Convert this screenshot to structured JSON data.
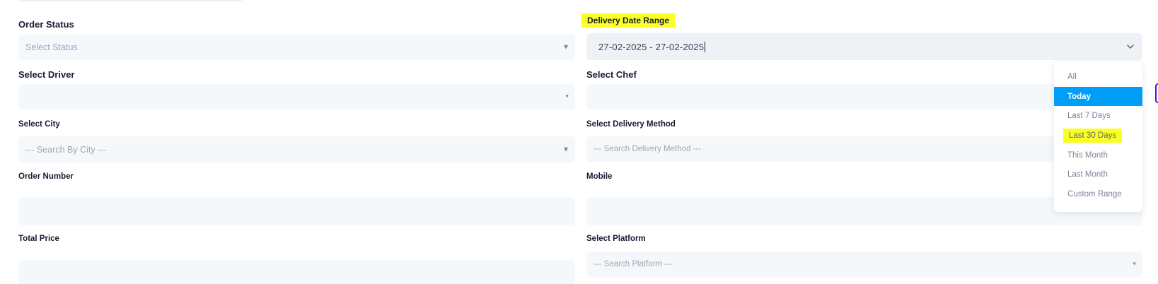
{
  "filters": {
    "order_status": {
      "label": "Order Status",
      "placeholder": "Select Status"
    },
    "delivery_date_range": {
      "label": "Delivery Date Range",
      "value": "27-02-2025 - 27-02-2025"
    },
    "select_driver": {
      "label": "Select Driver",
      "placeholder": ""
    },
    "select_chef": {
      "label": "Select Chef",
      "placeholder": ""
    },
    "select_city": {
      "label": "Select City",
      "placeholder": "--- Search By City ---"
    },
    "select_delivery_method": {
      "label": "Select Delivery Method",
      "placeholder": "--- Search Delivery Method ---"
    },
    "order_number": {
      "label": "Order Number",
      "value": ""
    },
    "mobile": {
      "label": "Mobile",
      "value": ""
    },
    "total_price": {
      "label": "Total Price",
      "value": ""
    },
    "select_platform": {
      "label": "Select Platform",
      "placeholder": "--- Search Platform ---"
    }
  },
  "date_range_dropdown": {
    "items": [
      {
        "label": "All",
        "state": "normal"
      },
      {
        "label": "Today",
        "state": "active"
      },
      {
        "label": "Last 7 Days",
        "state": "normal"
      },
      {
        "label": "Last 30 Days",
        "state": "highlighted"
      },
      {
        "label": "This Month",
        "state": "normal"
      },
      {
        "label": "Last Month",
        "state": "normal"
      },
      {
        "label": "Custom Range",
        "state": "normal"
      }
    ]
  },
  "colors": {
    "highlight": "#fbff26",
    "active_item": "#009ef7",
    "field_bg": "#f5f8fa",
    "label_text": "#181c32",
    "placeholder_text": "#a1a5b7"
  }
}
